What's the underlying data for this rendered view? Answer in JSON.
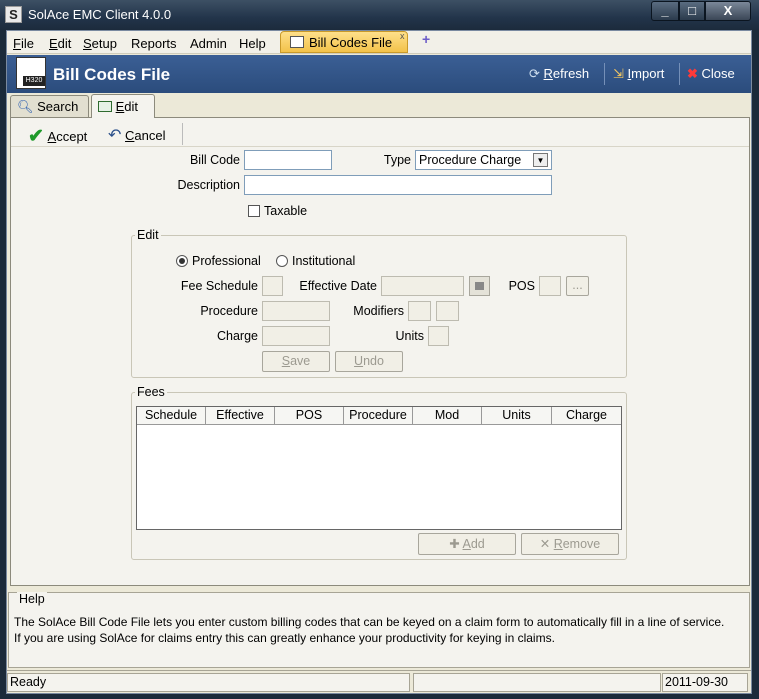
{
  "window": {
    "title": "SolAce EMC Client 4.0.0",
    "controls": [
      "_",
      "□",
      "X"
    ]
  },
  "menu": {
    "items": [
      {
        "label": "File",
        "mnemonic": "F",
        "rest": "ile"
      },
      {
        "label": "Edit",
        "mnemonic": "E",
        "rest": "dit"
      },
      {
        "label": "Setup",
        "mnemonic": "S",
        "rest": "etup"
      },
      {
        "label": "Reports"
      },
      {
        "label": "Admin"
      },
      {
        "label": "Help"
      }
    ]
  },
  "doc_tab": {
    "label": "Bill Codes File",
    "close": "x",
    "new_tab": "+"
  },
  "header": {
    "title": "Bill Codes File",
    "icon_badge": "H320",
    "refresh_label": "Refresh",
    "refresh_mn": "R",
    "refresh_rest": "efresh",
    "import_label": "Import",
    "import_mn": "I",
    "import_rest": "mport",
    "close_label": "Close"
  },
  "tabs": {
    "search": "Search",
    "edit": "Edit",
    "edit_mn": "E",
    "edit_rest": "dit"
  },
  "actions": {
    "accept_mn": "A",
    "accept_rest": "ccept",
    "cancel_mn": "C",
    "cancel_rest": "ancel"
  },
  "form": {
    "bill_code_label": "Bill Code",
    "bill_code_value": "",
    "type_label": "Type",
    "type_value": "Procedure Charge",
    "description_label": "Description",
    "description_value": "",
    "taxable_label": "Taxable",
    "taxable_checked": false
  },
  "edit_group": {
    "title": "Edit",
    "professional_label": "Professional",
    "professional_selected": true,
    "institutional_label": "Institutional",
    "fee_schedule_label": "Fee Schedule",
    "effective_date_label": "Effective Date",
    "pos_label": "POS",
    "pos_button": "...",
    "procedure_label": "Procedure",
    "modifiers_label": "Modifiers",
    "charge_label": "Charge",
    "units_label": "Units",
    "save_mn": "S",
    "save_rest": "ave",
    "undo_mn": "U",
    "undo_rest": "ndo"
  },
  "fees_group": {
    "title": "Fees",
    "columns": [
      "Schedule",
      "Effective",
      "POS",
      "Procedure",
      "Mod",
      "Units",
      "Charge"
    ],
    "rows": [],
    "add_mn": "A",
    "add_rest": "dd",
    "remove_mn": "R",
    "remove_rest": "emove"
  },
  "help": {
    "title": "Help",
    "line1": "The SolAce Bill Code File lets you enter custom billing codes that can be keyed on a claim form to automatically fill in a line of service.",
    "line2": "If you are using SolAce for claims entry this can greatly enhance your productivity for keying in claims."
  },
  "status": {
    "left": "Ready",
    "middle": "",
    "date": "2011-09-30"
  },
  "colors": {
    "header_bg": "#2b4c7c",
    "doc_tab_bg": "#f2c24a",
    "accept_check": "#1f9a2a",
    "close_x": "#d22"
  }
}
